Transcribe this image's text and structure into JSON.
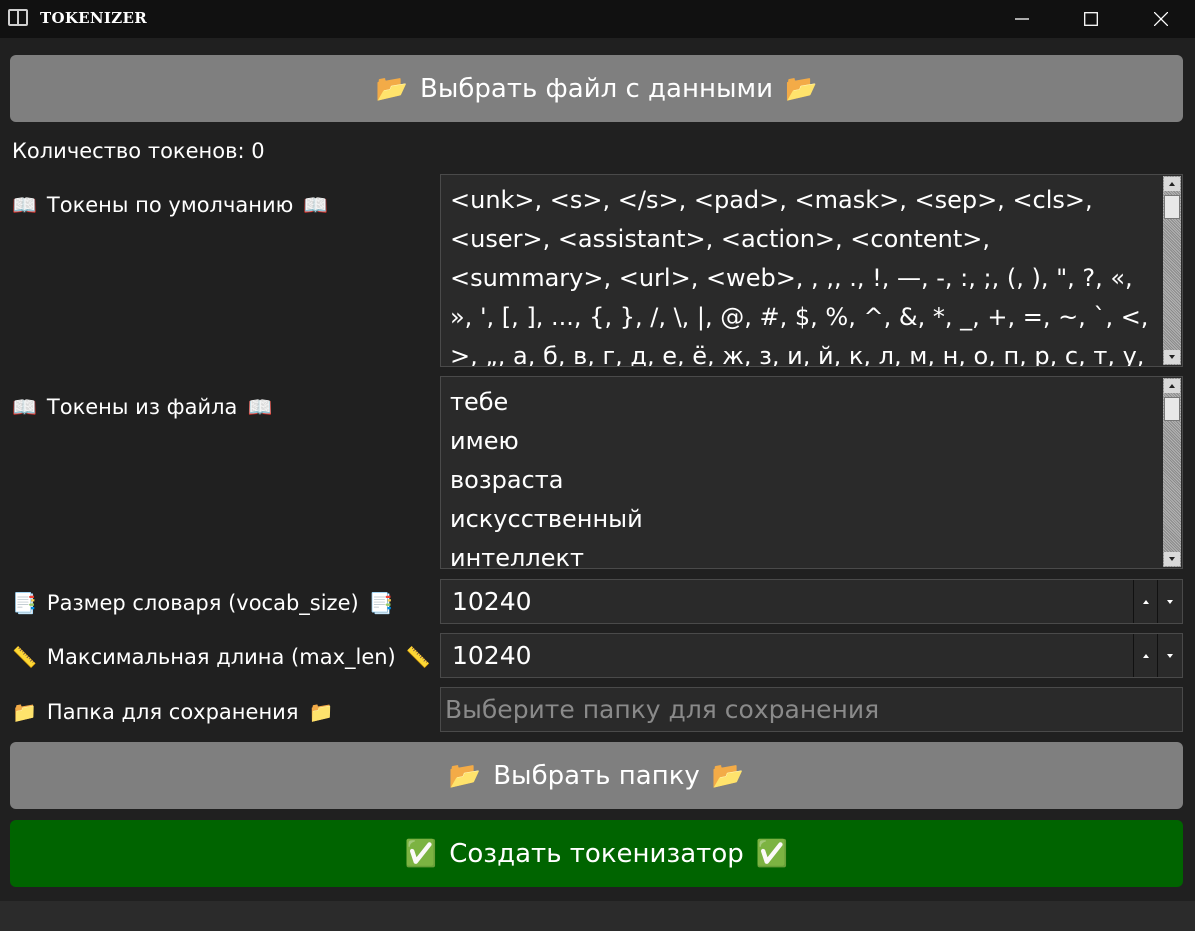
{
  "window": {
    "title": "TOKENIZER",
    "controls": {
      "minimize": "minimize-icon",
      "maximize": "maximize-icon",
      "close": "close-icon"
    }
  },
  "actions": {
    "select_file": {
      "icon": "📂",
      "label": "Выбрать файл с данными"
    },
    "select_folder": {
      "icon": "📂",
      "label": "Выбрать папку"
    },
    "create_tokenizer": {
      "icon": "✅",
      "label": "Создать токенизатор"
    }
  },
  "token_count": {
    "text": "Количество токенов: 0"
  },
  "default_tokens": {
    "icon": "📖",
    "label": "Токены по умолчанию",
    "text": "<unk>, <s>, </s>, <pad>, <mask>, <sep>, <cls>, <user>, <assistant>, <action>, <content>, <summary>, <url>, <web>,  , ,, ., !, —, -, :, ;, (, ), \", ?, «, », ', [, ], ..., {, }, /, \\, |, @, #, $, %, ^, &, *, _, +, =, ~, `, <, >, „, а, б, в, г, д, е, ё, ж, з, и, й, к, л, м, н, о, п, р, с, т, у, ф, х, ц, ч, ш, щ, ъ, ы"
  },
  "file_tokens": {
    "icon": "📖",
    "label": "Токены из файла",
    "items": [
      "тебе",
      "имею",
      "возраста",
      "искусственный",
      "интеллект"
    ]
  },
  "vocab_size": {
    "icon": "📑",
    "label": "Размер словаря (vocab_size)",
    "value": "10240"
  },
  "max_len": {
    "icon": "📏",
    "label": "Максимальная длина (max_len)",
    "value": "10240"
  },
  "save_folder": {
    "icon": "📁",
    "label": "Папка для сохранения",
    "placeholder": "Выберите папку для сохранения",
    "value": ""
  },
  "colors": {
    "grey_button": "#7f7f7f",
    "green_button": "#006400",
    "background": "#202020",
    "titlebar": "#111111"
  }
}
